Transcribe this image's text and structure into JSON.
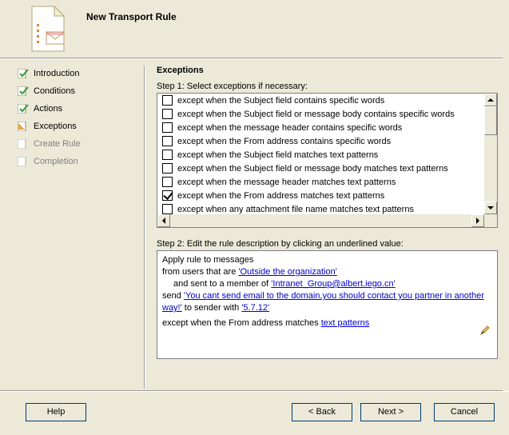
{
  "header": {
    "title": "New Transport Rule"
  },
  "sidebar": {
    "items": [
      {
        "label": "Introduction",
        "state": "done"
      },
      {
        "label": "Conditions",
        "state": "done"
      },
      {
        "label": "Actions",
        "state": "done"
      },
      {
        "label": "Exceptions",
        "state": "current"
      },
      {
        "label": "Create Rule",
        "state": "pending"
      },
      {
        "label": "Completion",
        "state": "pending"
      }
    ]
  },
  "main": {
    "section_title": "Exceptions",
    "step1_label": "Step 1: Select exceptions if necessary:",
    "exceptions": [
      {
        "label": "except when the Subject field contains specific words",
        "checked": false
      },
      {
        "label": "except when the Subject field or message body contains specific words",
        "checked": false
      },
      {
        "label": "except when the message header contains specific words",
        "checked": false
      },
      {
        "label": "except when the From address contains specific words",
        "checked": false
      },
      {
        "label": "except when the Subject field matches text patterns",
        "checked": false
      },
      {
        "label": "except when the Subject field or message body matches text patterns",
        "checked": false
      },
      {
        "label": "except when the message header matches text patterns",
        "checked": false
      },
      {
        "label": "except when the From address matches text patterns",
        "checked": true
      },
      {
        "label": "except when any attachment file name matches text patterns",
        "checked": false
      }
    ],
    "step2_label": "Step 2: Edit the rule description by clicking an underlined value:",
    "description": {
      "line1": "Apply rule to messages",
      "line2_pre": "from users that are ",
      "line2_link": "'Outside the organization'",
      "line3_pre": "and sent to a member of ",
      "line3_link": "'Intranet_Group@albert.iego.cn'",
      "line4_pre": "send ",
      "line4_link1": "'You cant send email to the domain,you should contact you  partner in another way!'",
      "line4_mid": " to sender with ",
      "line4_link2": "'5.7.12'",
      "line5_pre": "except when the From address matches ",
      "line5_link": "text patterns"
    }
  },
  "footer": {
    "help": "Help",
    "back": "< Back",
    "next": "Next >",
    "cancel": "Cancel"
  }
}
